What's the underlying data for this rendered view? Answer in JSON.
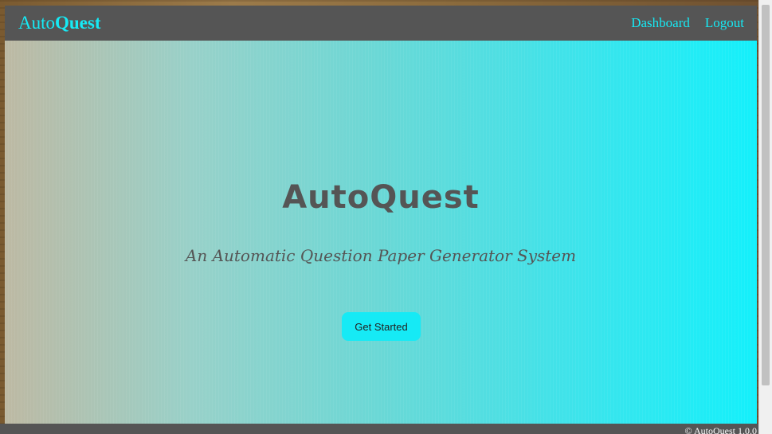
{
  "navbar": {
    "brand_light": "Auto",
    "brand_bold": "Quest",
    "links": [
      "Dashboard",
      "Logout"
    ]
  },
  "hero": {
    "title": "AutoQuest",
    "subtitle": "An Automatic Question Paper Generator System",
    "cta_label": "Get Started"
  },
  "footer": {
    "text": "© AutoQuest 1.0.0"
  },
  "colors": {
    "accent": "#16eaf5",
    "navbar_bg": "#555555",
    "text_dark": "#555555"
  }
}
